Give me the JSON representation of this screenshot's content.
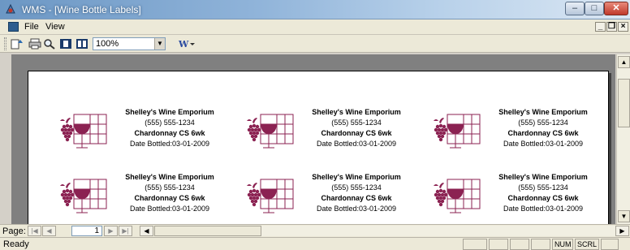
{
  "window": {
    "title": "WMS - [Wine Bottle Labels]"
  },
  "menu": {
    "file": "File",
    "view": "View"
  },
  "toolbar": {
    "zoom": "100%"
  },
  "labels": [
    {
      "shop": "Shelley's Wine Emporium",
      "phone": "(555) 555-1234",
      "wine": "Chardonnay CS 6wk",
      "bottled": "Date Bottled:03-01-2009"
    },
    {
      "shop": "Shelley's Wine Emporium",
      "phone": "(555) 555-1234",
      "wine": "Chardonnay CS 6wk",
      "bottled": "Date Bottled:03-01-2009"
    },
    {
      "shop": "Shelley's Wine Emporium",
      "phone": "(555) 555-1234",
      "wine": "Chardonnay CS 6wk",
      "bottled": "Date Bottled:03-01-2009"
    },
    {
      "shop": "Shelley's Wine Emporium",
      "phone": "(555) 555-1234",
      "wine": "Chardonnay CS 6wk",
      "bottled": "Date Bottled:03-01-2009"
    },
    {
      "shop": "Shelley's Wine Emporium",
      "phone": "(555) 555-1234",
      "wine": "Chardonnay CS 6wk",
      "bottled": "Date Bottled:03-01-2009"
    },
    {
      "shop": "Shelley's Wine Emporium",
      "phone": "(555) 555-1234",
      "wine": "Chardonnay CS 6wk",
      "bottled": "Date Bottled:03-01-2009"
    }
  ],
  "navigation": {
    "page_label": "Page:",
    "page_number": "1"
  },
  "status": {
    "text": "Ready",
    "num": "NUM",
    "scrl": "SCRL"
  },
  "colors": {
    "logo": "#8b2252"
  }
}
